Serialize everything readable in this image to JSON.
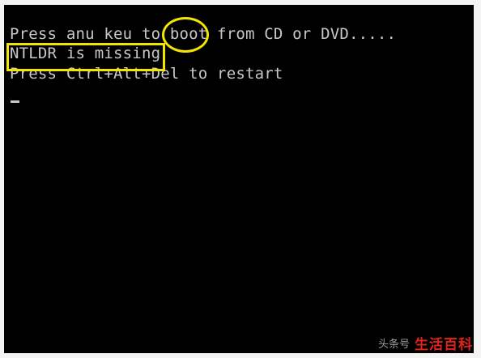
{
  "terminal": {
    "line1": "Press anu keu to boot from CD or DVD.....",
    "line2": "NTLDR is missing",
    "line3": "Press Ctrl+Alt+Del to restart"
  },
  "watermark": {
    "source": "头条号",
    "brand": "生活百科"
  },
  "colors": {
    "screen_bg": "#000000",
    "terminal_text": "#c8c8c8",
    "highlight": "#f2e600",
    "brand": "#e2231a"
  }
}
